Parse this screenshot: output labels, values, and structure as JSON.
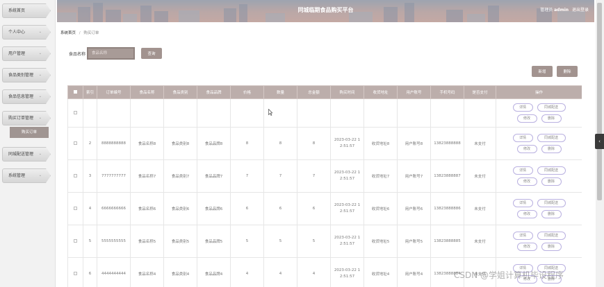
{
  "header": {
    "title": "同城临期食品购买平台",
    "user_role_label": "管理员",
    "username": "admin",
    "logout_label": "退出登录"
  },
  "sidebar": {
    "items": [
      {
        "label": "系统首页",
        "chevron": ""
      },
      {
        "label": "个人中心",
        "chevron": "⌄"
      },
      {
        "label": "用户管理",
        "chevron": "⌄"
      },
      {
        "label": "食品类别管理",
        "chevron": "⌄"
      },
      {
        "label": "食品信息管理",
        "chevron": "⌄"
      },
      {
        "label": "购买订单管理",
        "chevron": "⌄"
      },
      {
        "label": "同城配送管理",
        "chevron": "⌄"
      },
      {
        "label": "系统管理",
        "chevron": "⌄"
      }
    ],
    "active_sub": "购买订单"
  },
  "breadcrumb": {
    "home": "系统首页",
    "separator": "/",
    "current": "购买订单"
  },
  "search": {
    "label": "食品名称",
    "placeholder": "食品名称",
    "button": "查询"
  },
  "actions": {
    "add": "新增",
    "delete": "删除"
  },
  "table": {
    "columns": [
      "索引",
      "订单编号",
      "食品名称",
      "食品类别",
      "食品品牌",
      "价格",
      "数量",
      "总金额",
      "购买时间",
      "收货地址",
      "用户账号",
      "手机号码",
      "是否支付",
      "操作"
    ],
    "ops": {
      "detail": "详情",
      "deliver": "同城配送",
      "edit": "修改",
      "delete": "删除"
    },
    "rows": [
      {
        "index": "",
        "order_no": "",
        "food_name": "",
        "category": "",
        "brand": "",
        "price": "",
        "qty": "",
        "total": "",
        "time_a": "",
        "time_b": "",
        "address": "",
        "account": "",
        "phone": "",
        "paid": ""
      },
      {
        "index": "2",
        "order_no": "8888888888",
        "food_name": "食品名称8",
        "category": "食品类别8",
        "brand": "食品品牌8",
        "price": "8",
        "qty": "8",
        "total": "8",
        "time_a": "2023-03-22 1",
        "time_b": "2:51:57",
        "address": "收货地址8",
        "account": "用户账号8",
        "phone": "13823888888",
        "paid": "未支付"
      },
      {
        "index": "3",
        "order_no": "7777777777",
        "food_name": "食品名称7",
        "category": "食品类别7",
        "brand": "食品品牌7",
        "price": "7",
        "qty": "7",
        "total": "7",
        "time_a": "2023-03-22 1",
        "time_b": "2:51:57",
        "address": "收货地址7",
        "account": "用户账号7",
        "phone": "13823888887",
        "paid": "未支付"
      },
      {
        "index": "4",
        "order_no": "6666666666",
        "food_name": "食品名称6",
        "category": "食品类别6",
        "brand": "食品品牌6",
        "price": "6",
        "qty": "6",
        "total": "6",
        "time_a": "2023-03-22 1",
        "time_b": "2:51:57",
        "address": "收货地址6",
        "account": "用户账号6",
        "phone": "13823888886",
        "paid": "未支付"
      },
      {
        "index": "5",
        "order_no": "5555555555",
        "food_name": "食品名称5",
        "category": "食品类别5",
        "brand": "食品品牌5",
        "price": "5",
        "qty": "5",
        "total": "5",
        "time_a": "2023-03-22 1",
        "time_b": "2:51:57",
        "address": "收货地址5",
        "account": "用户账号5",
        "phone": "13823888885",
        "paid": "未支付"
      },
      {
        "index": "6",
        "order_no": "4444444444",
        "food_name": "食品名称4",
        "category": "食品类别4",
        "brand": "食品品牌4",
        "price": "4",
        "qty": "4",
        "total": "4",
        "time_a": "2023-03-22 1",
        "time_b": "2:51:57",
        "address": "收货地址4",
        "account": "用户账号4",
        "phone": "13823888884",
        "paid": "未支付"
      }
    ]
  },
  "side_toggle": "‹",
  "watermark": "CSDN @学姐计算机毕设程序",
  "colors": {
    "accent": "#a2938f",
    "table_header": "#bcaeab",
    "op_border": "#b9b0e0"
  }
}
